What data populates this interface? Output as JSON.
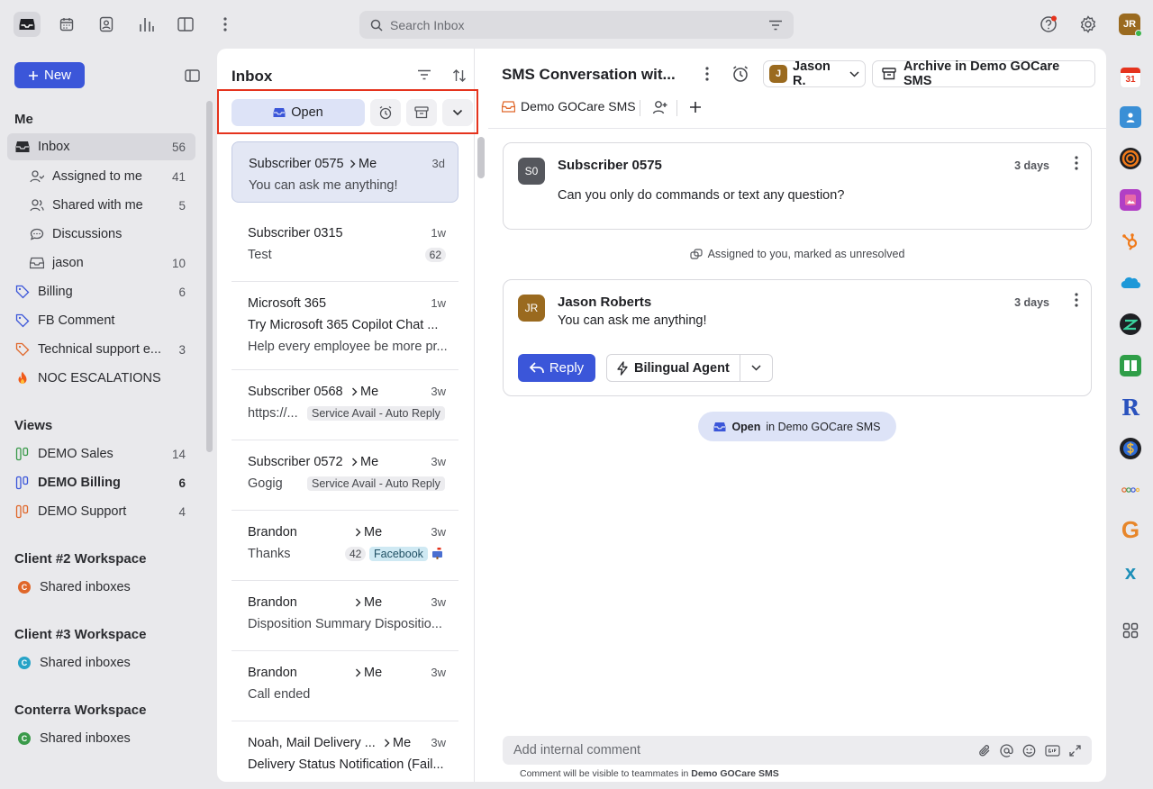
{
  "topbar": {
    "search_placeholder": "Search Inbox",
    "avatar_initials": "JR"
  },
  "leftnav": {
    "new_label": "New",
    "me_title": "Me",
    "items": [
      {
        "label": "Inbox",
        "count": "56"
      },
      {
        "label": "Assigned to me",
        "count": "41"
      },
      {
        "label": "Shared with me",
        "count": "5"
      },
      {
        "label": "Discussions",
        "count": ""
      },
      {
        "label": "jason",
        "count": "10"
      },
      {
        "label": "Billing",
        "count": "6"
      },
      {
        "label": "FB Comment",
        "count": ""
      },
      {
        "label": "Technical support e...",
        "count": "3"
      },
      {
        "label": "NOC ESCALATIONS",
        "count": ""
      }
    ],
    "views_title": "Views",
    "views": [
      {
        "label": "DEMO Sales",
        "count": "14",
        "color": "#3a9a4a"
      },
      {
        "label": "DEMO Billing",
        "count": "6",
        "color": "#3b56d9"
      },
      {
        "label": "DEMO Support",
        "count": "4",
        "color": "#e0672a"
      }
    ],
    "workspaces": [
      {
        "title": "Client #2 Workspace",
        "item": "Shared inboxes",
        "letter": "C",
        "color": "#e0672a"
      },
      {
        "title": "Client #3 Workspace",
        "item": "Shared inboxes",
        "letter": "C",
        "color": "#27a3c7"
      },
      {
        "title": "Conterra Workspace",
        "item": "Shared inboxes",
        "letter": "C",
        "color": "#3a9a4a"
      }
    ]
  },
  "inbox": {
    "title": "Inbox",
    "open_label": "Open",
    "conversations": [
      {
        "from": "Subscriber 0575",
        "me": "Me",
        "time": "3d",
        "line1": "You can ask me anything!"
      },
      {
        "from": "Subscriber 0315",
        "time": "1w",
        "line1": "Test",
        "count": "62"
      },
      {
        "from": "Microsoft 365",
        "time": "1w",
        "line1": "Try Microsoft 365 Copilot Chat ...",
        "line2": "Help every employee be more pr..."
      },
      {
        "from": "Subscriber 0568",
        "me": "Me",
        "time": "3w",
        "line1": "https://...",
        "tag": "Service Avail - Auto Reply"
      },
      {
        "from": "Subscriber 0572",
        "me": "Me",
        "time": "3w",
        "line1": "Gogig",
        "tag": "Service Avail - Auto Reply"
      },
      {
        "from": "Brandon",
        "me": "Me",
        "time": "3w",
        "line1": "Thanks",
        "count": "42",
        "tag": "Facebook"
      },
      {
        "from": "Brandon",
        "me": "Me",
        "time": "3w",
        "line1": "Disposition Summary Dispositio..."
      },
      {
        "from": "Brandon",
        "me": "Me",
        "time": "3w",
        "line1": "Call ended"
      },
      {
        "from": "Noah, Mail Delivery ...",
        "me": "Me",
        "time": "3w",
        "line1": "Delivery Status Notification (Fail..."
      }
    ]
  },
  "conversation": {
    "title": "SMS Conversation wit...",
    "assignee_initial": "J",
    "assignee_name": "Jason R.",
    "archive_label": "Archive in Demo GOCare SMS",
    "inbox_name": "Demo GOCare SMS",
    "messages": [
      {
        "initials": "S0",
        "name": "Subscriber 0575",
        "time": "3 days",
        "body": "Can you only do commands or text any question?",
        "avatar_color": "#55575d"
      },
      {
        "initials": "JR",
        "name": "Jason Roberts",
        "time": "3 days",
        "body": "You can ask me anything!",
        "avatar_color": "#9a6a1f"
      }
    ],
    "event_text": "Assigned to you, marked as unresolved",
    "reply_label": "Reply",
    "agent_label": "Bilingual Agent",
    "status_open": "Open",
    "status_rest": "in Demo GOCare SMS",
    "comment_placeholder": "Add internal comment",
    "comment_note_prefix": "Comment will be visible to teammates in",
    "comment_note_inbox": "Demo GOCare SMS"
  },
  "apps": {
    "calendar_day": "31",
    "r_letter": "R",
    "g_letter": "G",
    "x_letter": "x"
  }
}
